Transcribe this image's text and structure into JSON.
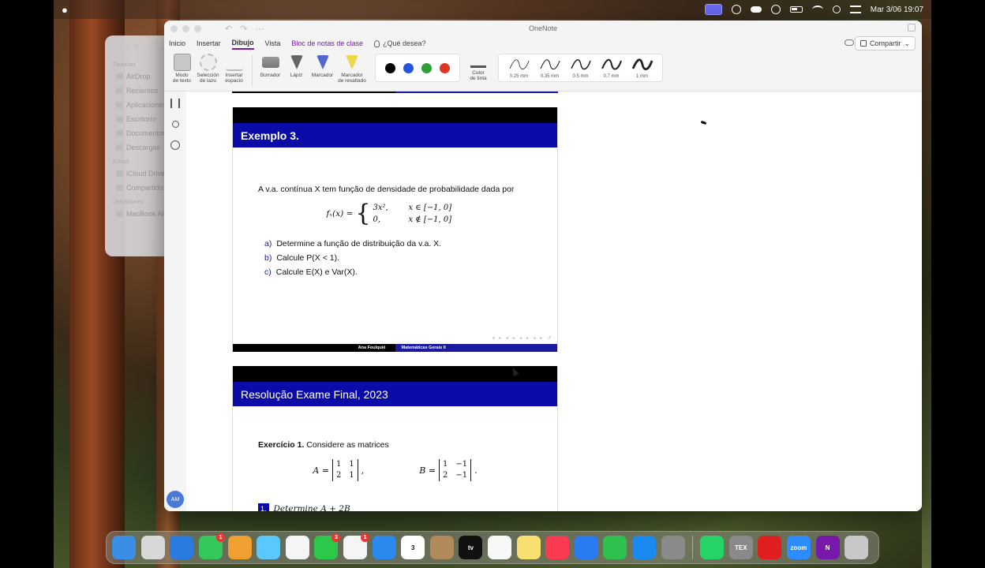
{
  "menubar": {
    "clock": "Mar 3/06 19:07"
  },
  "window": {
    "title": "OneNote",
    "tabs": [
      {
        "label": "Inicio"
      },
      {
        "label": "Insertar"
      },
      {
        "label": "Dibujo"
      },
      {
        "label": "Vista"
      },
      {
        "label": "Bloc de notas de clase"
      }
    ],
    "tell_me": "¿Qué desea?",
    "share": "Compartir"
  },
  "ribbon": {
    "tools": [
      {
        "line1": "Modo",
        "line2": "de texto"
      },
      {
        "line1": "Selección",
        "line2": "de lazo"
      },
      {
        "line1": "Insertar",
        "line2": "espacio"
      }
    ],
    "pens": [
      {
        "line1": "Borrador",
        "line2": ""
      },
      {
        "line1": "Lápiz",
        "line2": ""
      },
      {
        "line1": "Marcador",
        "line2": ""
      },
      {
        "line1": "Marcador",
        "line2": "de resaltado"
      }
    ],
    "colors": [
      "#000000",
      "#2255dd",
      "#2e9e3a",
      "#dd3322"
    ],
    "ink_color": {
      "line1": "Color",
      "line2": "de tinta"
    },
    "strokes": [
      "0.25 mm",
      "0.35 mm",
      "0.5 mm",
      "0.7 mm",
      "1 mm"
    ]
  },
  "finder": {
    "favorites_label": "Favoritos",
    "favorites": [
      "AirDrop",
      "Recientes",
      "Aplicaciones",
      "Escritorio",
      "Documentos",
      "Descargas"
    ],
    "icloud_label": "iCloud",
    "icloud": [
      "iCloud Drive",
      "Compartido"
    ],
    "locations_label": "Ubicaciones",
    "locations": [
      "MacBook Air"
    ]
  },
  "user": {
    "initials": "AM"
  },
  "slide1": {
    "title": "Exemplo 3.",
    "intro": "A v.a. contínua X tem função de densidade de probabilidade dada por",
    "f_lhs": "fₓ(x) =",
    "case1_val": "3x²,",
    "case1_cond": "x ∈ [−1, 0]",
    "case2_val": "0,",
    "case2_cond": "x ∉ [−1, 0]",
    "items": [
      {
        "label": "a)",
        "text": "Determine a função de distribuição da v.a. X."
      },
      {
        "label": "b)",
        "text": "Calcule P(X < 1)."
      },
      {
        "label": "c)",
        "text": "Calcule E(X) e Var(X)."
      }
    ],
    "footer_left": "Ana Foulquié",
    "footer_right": "Matemáticas Gerais II"
  },
  "slide2": {
    "title": "Resolução Exame Final, 2023",
    "exercise_label": "Exercício 1.",
    "exercise_text": "Considere as matrices",
    "matA_name": "A =",
    "matA": [
      "1",
      "1",
      "2",
      "1"
    ],
    "matB_name": "B =",
    "matB": [
      "1",
      "−1",
      "2",
      "−1"
    ],
    "item1_num": "1.",
    "item1_text": "Determine A + 2B"
  },
  "dock": {
    "apps": [
      {
        "name": "finder",
        "color": "#3a8ee6"
      },
      {
        "name": "launchpad",
        "color": "#d8d8d8"
      },
      {
        "name": "safari",
        "color": "#2a7ae0"
      },
      {
        "name": "messages",
        "color": "#34c759",
        "badge": "1"
      },
      {
        "name": "pencil",
        "color": "#f0a030"
      },
      {
        "name": "maps",
        "color": "#5ac8fa"
      },
      {
        "name": "photos",
        "color": "#f5f5f5"
      },
      {
        "name": "facetime",
        "color": "#2cc84a",
        "badge": "3"
      },
      {
        "name": "reminders",
        "color": "#f5f5f5",
        "badge": "1"
      },
      {
        "name": "mail",
        "color": "#2a8af0"
      },
      {
        "name": "calendar",
        "color": "#ffffff",
        "label": "3"
      },
      {
        "name": "box",
        "color": "#b08a5a"
      },
      {
        "name": "appletv",
        "color": "#111111",
        "label": "tv"
      },
      {
        "name": "freeform",
        "color": "#f8f8f8"
      },
      {
        "name": "notes",
        "color": "#f8e070"
      },
      {
        "name": "music",
        "color": "#fa3a50"
      },
      {
        "name": "keynote",
        "color": "#2a7af0"
      },
      {
        "name": "numbers",
        "color": "#30c050"
      },
      {
        "name": "appstore",
        "color": "#1a8af0"
      },
      {
        "name": "settings",
        "color": "#8a8a8a"
      }
    ],
    "apps2": [
      {
        "name": "whatsapp",
        "color": "#25d366"
      },
      {
        "name": "tex",
        "color": "#8a8a8a",
        "label": "TEX"
      },
      {
        "name": "acrobat",
        "color": "#e02020"
      },
      {
        "name": "zoom",
        "color": "#2d8cff",
        "label": "zoom"
      },
      {
        "name": "onenote",
        "color": "#7719aa",
        "label": "N"
      },
      {
        "name": "trash",
        "color": "#c8c8c8"
      }
    ]
  }
}
